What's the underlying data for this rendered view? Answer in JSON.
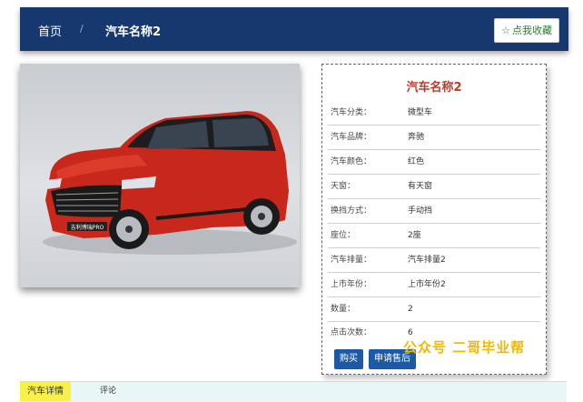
{
  "header": {
    "home_label": "首页",
    "separator": "/",
    "current_label": "汽车名称2",
    "favorite_button": "点我收藏"
  },
  "car": {
    "title": "汽车名称2",
    "badge_text": "吉利博瑞PRO",
    "specs": [
      {
        "label": "汽车分类：",
        "value": "微型车"
      },
      {
        "label": "汽车品牌：",
        "value": "奔驰"
      },
      {
        "label": "汽车颜色：",
        "value": "红色"
      },
      {
        "label": "天窗：",
        "value": "有天窗"
      },
      {
        "label": "换挡方式：",
        "value": "手动挡"
      },
      {
        "label": "座位：",
        "value": "2座"
      },
      {
        "label": "汽车排量：",
        "value": "汽车排量2"
      },
      {
        "label": "上市年份：",
        "value": "上市年份2"
      },
      {
        "label": "数量：",
        "value": "2"
      },
      {
        "label": "点击次数：",
        "value": "6"
      }
    ]
  },
  "actions": {
    "buy_label": "购买",
    "after_sales_label": "申请售后"
  },
  "watermark": "公众号 二哥毕业帮",
  "tabs": {
    "details_label": "汽车详情",
    "comments_label": "评论"
  },
  "colors": {
    "header_bg": "#17386f",
    "title_red": "#c0392b",
    "button_blue": "#1d5aa6",
    "active_tab": "#f7f14a",
    "favorite_green": "#2e7d32"
  }
}
